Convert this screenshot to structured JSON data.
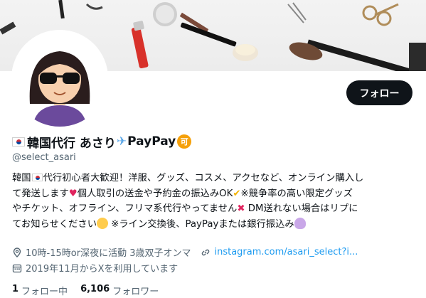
{
  "profile": {
    "name": "韓国代行 あさり",
    "name_suffix": "PayPay",
    "badge": "可",
    "handle": "@select_asari",
    "follow_label": "フォロー"
  },
  "bio": {
    "line1_a": "韓国",
    "line1_b": "代行初心者大歓迎！洋服、グッズ、コスメ、アクセなど、オンライン購入し",
    "line2_a": "て発送します",
    "line2_b": "個人取引の送金や予約金の振込みOK",
    "line2_c": "※競争率の高い限定グッズ",
    "line3_a": "やチケット、オフライン、フリマ系代行やってません",
    "line3_b": " DM送れない場合はリプに",
    "line4_a": "てお知らせください",
    "line4_b": " ※ライン交換後、PayPayまたは銀行振込み"
  },
  "meta": {
    "location": "10時-15時or深夜に活動 3歳双子オンマ",
    "link": "instagram.com/asari_select?i...",
    "joined": "2019年11月からXを利用しています"
  },
  "stats": {
    "following_count": "1",
    "following_label": "フォロー中",
    "followers_count": "6,106",
    "followers_label": "フォロワー"
  },
  "icons": [
    "location-icon",
    "link-icon",
    "calendar-icon",
    "korea-flag-icon",
    "airplane-icon"
  ],
  "colors": {
    "accent": "#1d9bf0",
    "button": "#0f1419",
    "secondary_text": "#536471",
    "badge": "#f5a00a"
  }
}
